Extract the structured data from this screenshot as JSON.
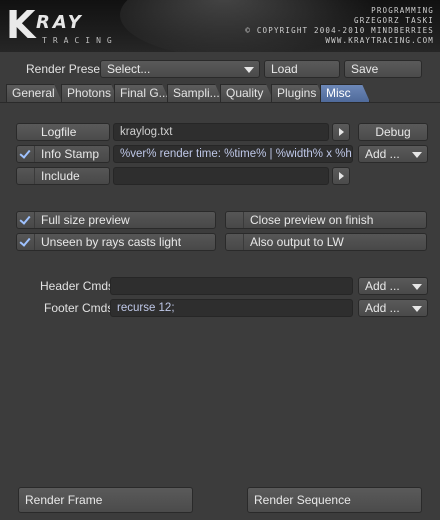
{
  "header": {
    "logo_mark": "K",
    "logo_word": "RAY",
    "logo_sub": "TRACING",
    "credits": [
      "PROGRAMMING",
      "GRZEGORZ TASKI",
      "© COPYRIGHT 2004-2010 MINDBERRIES",
      "WWW.KRAYTRACING.COM"
    ]
  },
  "preset": {
    "label": "Render Preset",
    "select_value": "Select...",
    "load_label": "Load",
    "save_label": "Save"
  },
  "tabs": [
    "General",
    "Photons",
    "Final G...",
    "Sampli...",
    "Quality",
    "Plugins",
    "Misc"
  ],
  "active_tab": "Misc",
  "logfile": {
    "button_label": "Logfile",
    "value": "kraylog.txt",
    "debug_label": "Debug"
  },
  "info_stamp": {
    "label": "Info Stamp",
    "checked": true,
    "value": "%ver% render time: %time% | %width% x %height%",
    "add_label": "Add ..."
  },
  "include": {
    "label": "Include",
    "checked": false,
    "value": ""
  },
  "options": {
    "full_size_preview": {
      "label": "Full size preview",
      "checked": true
    },
    "close_preview": {
      "label": "Close preview on finish",
      "checked": false
    },
    "unseen_by_rays": {
      "label": "Unseen by rays casts light",
      "checked": true
    },
    "output_to_lw": {
      "label": "Also output to LW",
      "checked": false
    }
  },
  "cmds": {
    "header_label": "Header Cmds",
    "header_value": "",
    "footer_label": "Footer Cmds",
    "footer_value": "recurse 12;",
    "add_label": "Add ..."
  },
  "footer": {
    "render_frame": "Render Frame",
    "render_sequence": "Render Sequence"
  },
  "colors": {
    "background": "#3c3c3c",
    "active_tab": "#5c78aa",
    "check_mark": "#9fc2ff"
  }
}
